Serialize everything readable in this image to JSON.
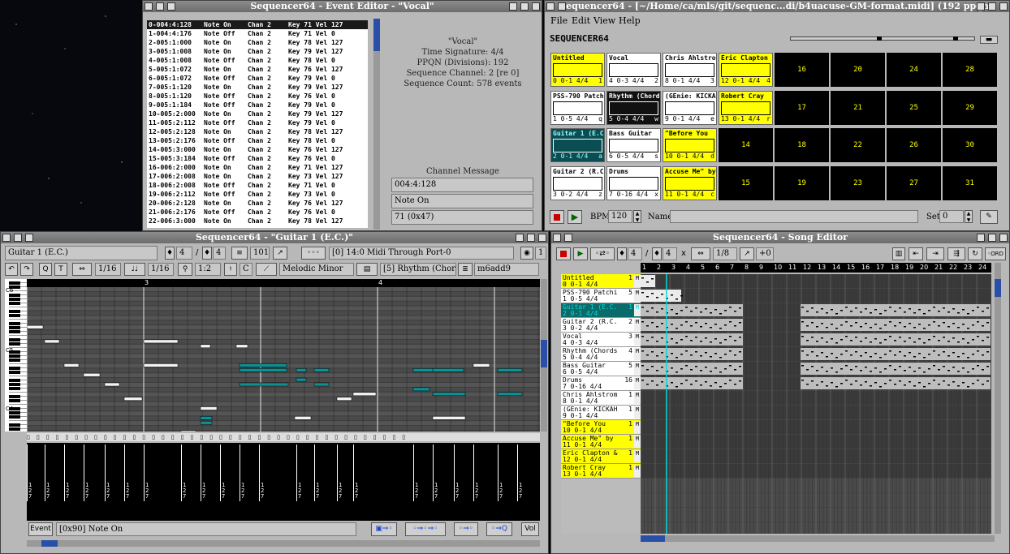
{
  "event_editor": {
    "title": "Sequencer64 - Event Editor - \"Vocal\"",
    "events": [
      {
        "time": "0-004:4:128",
        "type": "Note On",
        "chan": "Chan 2",
        "data": "Key 71 Vel 127"
      },
      {
        "time": "1-004:4:176",
        "type": "Note Off",
        "chan": "Chan 2",
        "data": "Key 71 Vel 0"
      },
      {
        "time": "2-005:1:000",
        "type": "Note On",
        "chan": "Chan 2",
        "data": "Key 78 Vel 127"
      },
      {
        "time": "3-005:1:008",
        "type": "Note On",
        "chan": "Chan 2",
        "data": "Key 79 Vel 127"
      },
      {
        "time": "4-005:1:008",
        "type": "Note Off",
        "chan": "Chan 2",
        "data": "Key 78 Vel 0"
      },
      {
        "time": "5-005:1:072",
        "type": "Note On",
        "chan": "Chan 2",
        "data": "Key 76 Vel 127"
      },
      {
        "time": "6-005:1:072",
        "type": "Note Off",
        "chan": "Chan 2",
        "data": "Key 79 Vel 0"
      },
      {
        "time": "7-005:1:120",
        "type": "Note On",
        "chan": "Chan 2",
        "data": "Key 79 Vel 127"
      },
      {
        "time": "8-005:1:120",
        "type": "Note Off",
        "chan": "Chan 2",
        "data": "Key 76 Vel 0"
      },
      {
        "time": "9-005:1:184",
        "type": "Note Off",
        "chan": "Chan 2",
        "data": "Key 79 Vel 0"
      },
      {
        "time": "10-005:2:000",
        "type": "Note On",
        "chan": "Chan 2",
        "data": "Key 79 Vel 127"
      },
      {
        "time": "11-005:2:112",
        "type": "Note Off",
        "chan": "Chan 2",
        "data": "Key 79 Vel 0"
      },
      {
        "time": "12-005:2:128",
        "type": "Note On",
        "chan": "Chan 2",
        "data": "Key 78 Vel 127"
      },
      {
        "time": "13-005:2:176",
        "type": "Note Off",
        "chan": "Chan 2",
        "data": "Key 78 Vel 0"
      },
      {
        "time": "14-005:3:000",
        "type": "Note On",
        "chan": "Chan 2",
        "data": "Key 76 Vel 127"
      },
      {
        "time": "15-005:3:184",
        "type": "Note Off",
        "chan": "Chan 2",
        "data": "Key 76 Vel 0"
      },
      {
        "time": "16-006:2:000",
        "type": "Note On",
        "chan": "Chan 2",
        "data": "Key 71 Vel 127"
      },
      {
        "time": "17-006:2:008",
        "type": "Note On",
        "chan": "Chan 2",
        "data": "Key 73 Vel 127"
      },
      {
        "time": "18-006:2:008",
        "type": "Note Off",
        "chan": "Chan 2",
        "data": "Key 71 Vel 0"
      },
      {
        "time": "19-006:2:112",
        "type": "Note Off",
        "chan": "Chan 2",
        "data": "Key 73 Vel 0"
      },
      {
        "time": "20-006:2:128",
        "type": "Note On",
        "chan": "Chan 2",
        "data": "Key 76 Vel 127"
      },
      {
        "time": "21-006:2:176",
        "type": "Note Off",
        "chan": "Chan 2",
        "data": "Key 76 Vel 0"
      },
      {
        "time": "22-006:3:000",
        "type": "Note On",
        "chan": "Chan 2",
        "data": "Key 78 Vel 127"
      }
    ],
    "info": {
      "name": "\"Vocal\"",
      "time_signature": "Time Signature: 4/4",
      "ppqn": "PPQN (Divisions): 192",
      "channel": "Sequence Channel: 2 [re 0]",
      "count": "Sequence Count: 578 events"
    },
    "channel_message_label": "Channel Message",
    "message_fields": [
      "004:4:128",
      "Note On",
      "71 (0x47)"
    ]
  },
  "main_window": {
    "title": "sequencer64 - [~/Home/ca/mls/git/sequenc...di/b4uacuse-GM-format.midi] (192 ppqn)",
    "menu": [
      "File",
      "Edit",
      "View",
      "Help"
    ],
    "logo": "SEQUENCER64",
    "slots": [
      {
        "name": "Untitled",
        "info": "0  0-1 4/4",
        "key": "1",
        "style": "yellow"
      },
      {
        "name": "Vocal",
        "info": "4  0-3 4/4",
        "key": "2",
        "style": "white"
      },
      {
        "name": "Chris Ahlstro",
        "info": "8  0-1 4/4",
        "key": "3",
        "style": "white"
      },
      {
        "name": "Eric Clapton",
        "info": "12 0-1 4/4",
        "key": "4",
        "style": "yellow"
      },
      {
        "name": "PSS-790 Patch",
        "info": "1  0-5 4/4",
        "key": "q",
        "style": "white"
      },
      {
        "name": "Rhythm (Chord",
        "info": "5  0-4 4/4",
        "key": "w",
        "style": "dark"
      },
      {
        "name": "(GEnie: KICKA",
        "info": "9  0-1 4/4",
        "key": "e",
        "style": "white"
      },
      {
        "name": "Robert Cray",
        "info": "13 0-1 4/4",
        "key": "r",
        "style": "yellow"
      },
      {
        "name": "Guitar 1 (E.C",
        "info": "2  0-1 4/4",
        "key": "a",
        "style": "teal"
      },
      {
        "name": "Bass Guitar",
        "info": "6  0-5 4/4",
        "key": "s",
        "style": "white"
      },
      {
        "name": "\"Before You",
        "info": "10 0-1 4/4",
        "key": "d",
        "style": "yellow"
      },
      {
        "name": "Guitar 2 (R.C",
        "info": "3  0-2 4/4",
        "key": "z",
        "style": "white"
      },
      {
        "name": "Drums",
        "info": "7  0-16 4/4",
        "key": "x",
        "style": "white"
      },
      {
        "name": "Accuse Me\" by",
        "info": "11 0-1 4/4",
        "key": "c",
        "style": "yellow"
      }
    ],
    "empty_slots": [
      "16",
      "20",
      "24",
      "28",
      "17",
      "21",
      "25",
      "29",
      "14",
      "18",
      "22",
      "26",
      "30",
      "15",
      "19",
      "23",
      "27",
      "31"
    ],
    "bpm_label": "BPM",
    "bpm_value": "120",
    "name_label": "Name",
    "set_label": "Set",
    "set_value": "0"
  },
  "seq_editor": {
    "title": "Sequencer64 - \"Guitar 1 (E.C.)\"",
    "seq_name": "Guitar 1 (E.C.)",
    "beats": "4",
    "beat_width": "4",
    "length": "101",
    "midi_port": "[0] 14:0 Midi Through Port-0",
    "channel": "1",
    "snap": "1/16",
    "note_len": "1/16",
    "zoom": "1:2",
    "key": "C",
    "scale": "Melodic Minor",
    "background_seq": "[5] Rhythm (Chord",
    "chord": "m6add9",
    "measure_labels": [
      "3",
      "4"
    ],
    "octave_labels": [
      "C6",
      "C5",
      "C4"
    ],
    "vel_labels": [
      "1\n2\n7"
    ],
    "event_label": "Event",
    "event_value": "[0x90] Note On",
    "vol_label": "Vol"
  },
  "song_editor": {
    "title": "Sequencer64 - Song Editor",
    "beats": "4",
    "beat_width": "4",
    "snap": "1/8",
    "transpose": "+0",
    "measures": [
      "1",
      "2",
      "3",
      "4",
      "5",
      "6",
      "7",
      "8",
      "9",
      "10",
      "11",
      "12",
      "13",
      "14",
      "15",
      "16",
      "17",
      "18",
      "19",
      "20",
      "21",
      "22",
      "23",
      "24"
    ],
    "tracks": [
      {
        "name": "Untitled",
        "info": "0  0-1 4/4",
        "count": "1",
        "style": "yellow"
      },
      {
        "name": "PSS-790 Patchi",
        "info": "1  0-5 4/4",
        "count": "5",
        "style": "white"
      },
      {
        "name": "Guitar 1 (E.C.",
        "info": "2  0-1 4/4",
        "count": "1",
        "style": "teal"
      },
      {
        "name": "Guitar 2 (R.C.",
        "info": "3  0-2 4/4",
        "count": "2",
        "style": "white"
      },
      {
        "name": "Vocal",
        "info": "4  0-3 4/4",
        "count": "3",
        "style": "white"
      },
      {
        "name": "Rhythm (Chords",
        "info": "5  0-4 4/4",
        "count": "4",
        "style": "white"
      },
      {
        "name": "Bass Guitar",
        "info": "6  0-5 4/4",
        "count": "5",
        "style": "white"
      },
      {
        "name": "Drums",
        "info": "7  0-16 4/4",
        "count": "16",
        "style": "white"
      },
      {
        "name": "Chris Ahlstrom",
        "info": "8  0-1 4/4",
        "count": "1",
        "style": "white"
      },
      {
        "name": "(GEnie: KICKAH",
        "info": "9  0-1 4/4",
        "count": "1",
        "style": "white"
      },
      {
        "name": "\"Before You",
        "info": "10 0-1 4/4",
        "count": "1",
        "style": "yellow"
      },
      {
        "name": "Accuse Me\" by",
        "info": "11 0-1 4/4",
        "count": "1",
        "style": "yellow"
      },
      {
        "name": "Eric Clapton &",
        "info": "12 0-1 4/4",
        "count": "1",
        "style": "yellow"
      },
      {
        "name": "Robert Cray",
        "info": "13 0-1 4/4",
        "count": "1",
        "style": "yellow"
      }
    ],
    "mute_label": "M"
  },
  "colors": {
    "title_bg": "#7a7a7a",
    "window_bg": "#b8b8b8",
    "slot_yellow": "#ffff00",
    "note_teal": "#0e8f93",
    "grid_dark": "#3c3c3c"
  }
}
